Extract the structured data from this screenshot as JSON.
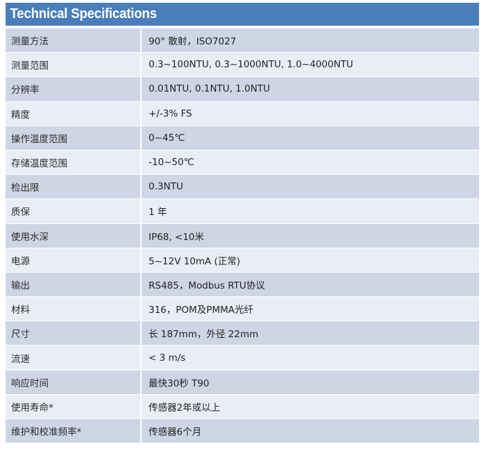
{
  "header": {
    "title": "Technical Specifications",
    "background_color": "#4a7ebb",
    "text_color": "#ffffff"
  },
  "table": {
    "row_colors": {
      "odd": "#ced5e5",
      "even": "#e9edf6",
      "divider": "#ffffff"
    },
    "rows": [
      {
        "label": "测量方法",
        "value": "90° 散射，ISO7027"
      },
      {
        "label": "测量范围",
        "value": "0.3~100NTU, 0.3~1000NTU, 1.0~4000NTU"
      },
      {
        "label": "分辨率",
        "value": "0.01NTU, 0.1NTU, 1.0NTU"
      },
      {
        "label": "精度",
        "value": "+/-3% FS"
      },
      {
        "label": "操作温度范围",
        "value": "0~45℃"
      },
      {
        "label": "存储温度范围",
        "value": "-10~50℃"
      },
      {
        "label": "检出限",
        "value": "0.3NTU"
      },
      {
        "label": "质保",
        "value": "1 年"
      },
      {
        "label": "使用水深",
        "value": "IP68, <10米"
      },
      {
        "label": "电源",
        "value": "5~12V 10mA (正常)"
      },
      {
        "label": "输出",
        "value": "RS485，Modbus RTU协议"
      },
      {
        "label": "材料",
        "value": "316，POM及PMMA光纤"
      },
      {
        "label": "尺寸",
        "value": "长 187mm，外径 22mm"
      },
      {
        "label": "流速",
        "value": "< 3 m/s"
      },
      {
        "label": "响应时间",
        "value": "最快30秒 T90"
      },
      {
        "label": "使用寿命*",
        "value": "传感器2年或以上"
      },
      {
        "label": "维护和校准频率*",
        "value": "传感器6个月"
      }
    ]
  }
}
